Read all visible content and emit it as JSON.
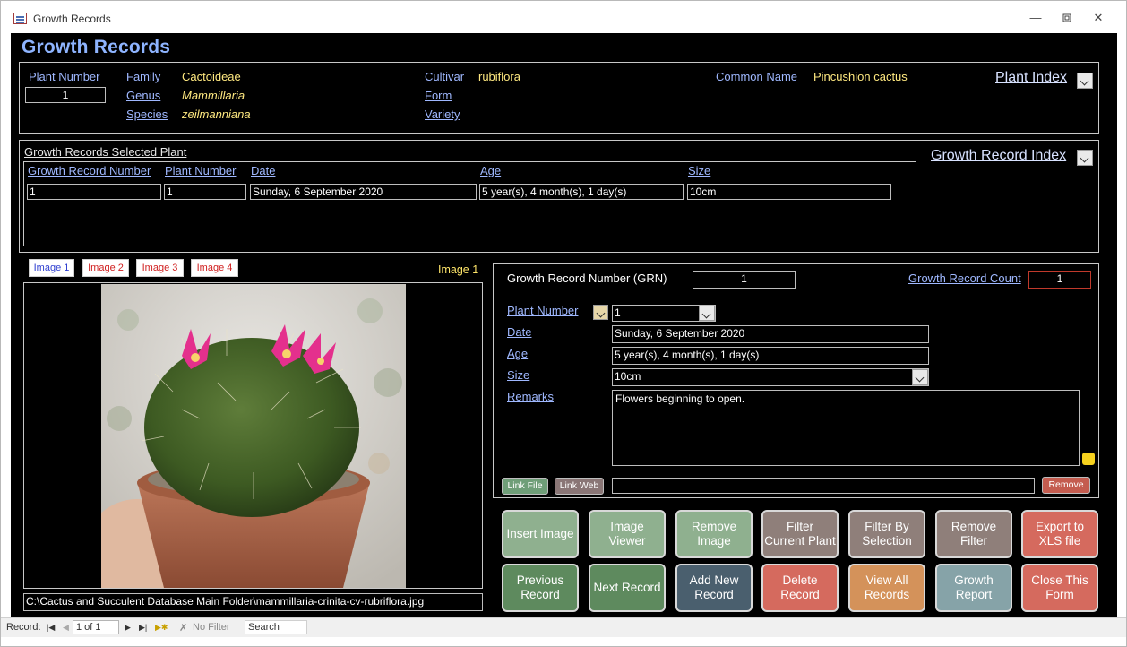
{
  "window": {
    "title": "Growth Records"
  },
  "form": {
    "title": "Growth Records"
  },
  "plant": {
    "plant_number_label": "Plant Number",
    "plant_number": "1",
    "family_label": "Family",
    "family": "Cactoideae",
    "genus_label": "Genus",
    "genus": "Mammillaria",
    "species_label": "Species",
    "species": "zeilmanniana",
    "cultivar_label": "Cultivar",
    "cultivar": "rubiflora",
    "form_label": "Form",
    "variety_label": "Variety",
    "common_name_label": "Common Name",
    "common_name": "Pincushion cactus",
    "plant_index_label": "Plant Index"
  },
  "selected": {
    "heading": "Growth Records Selected Plant",
    "growth_record_index_label": "Growth Record Index",
    "columns": [
      "Growth Record Number",
      "Plant Number",
      "Date",
      "Age",
      "Size"
    ],
    "row": [
      "1",
      "1",
      "Sunday, 6 September 2020",
      "5 year(s), 4 month(s), 1 day(s)",
      "10cm"
    ]
  },
  "images": {
    "tabs": [
      "Image 1",
      "Image 2",
      "Image 3",
      "Image 4"
    ],
    "current_label": "Image 1",
    "path": "C:\\Cactus and Succulent Database Main Folder\\mammillaria-crinita-cv-rubriflora.jpg"
  },
  "detail": {
    "grn_label": "Growth Record Number (GRN)",
    "grn": "1",
    "count_label": "Growth Record Count",
    "count": "1",
    "plant_number_label": "Plant Number",
    "plant_number": "1",
    "date_label": "Date",
    "date": "Sunday, 6 September 2020",
    "age_label": "Age",
    "age": "5 year(s), 4 month(s), 1 day(s)",
    "size_label": "Size",
    "size": "10cm",
    "remarks_label": "Remarks",
    "remarks": "Flowers beginning to open.",
    "link_file": "Link File",
    "link_web": "Link Web",
    "remove": "Remove"
  },
  "buttons": {
    "row1": [
      {
        "label": "Insert Image",
        "color": "#8fb08f"
      },
      {
        "label": "Image\nViewer",
        "color": "#8fb08f"
      },
      {
        "label": "Remove\nImage",
        "color": "#8fb08f"
      },
      {
        "label": "Filter\nCurrent Plant",
        "color": "#8f7f7a"
      },
      {
        "label": "Filter By\nSelection",
        "color": "#8f7f7a"
      },
      {
        "label": "Remove\nFilter",
        "color": "#8f7f7a"
      },
      {
        "label": "Export to\nXLS file",
        "color": "#d56a5e"
      }
    ],
    "row2": [
      {
        "label": "Previous\nRecord",
        "color": "#5e8a5e"
      },
      {
        "label": "Next Record",
        "color": "#5e8a5e"
      },
      {
        "label": "Add New\nRecord",
        "color": "#4a5f6e"
      },
      {
        "label": "Delete\nRecord",
        "color": "#d56a5e"
      },
      {
        "label": "View All\nRecords",
        "color": "#d4925a"
      },
      {
        "label": "Growth\nReport",
        "color": "#86a3a8"
      },
      {
        "label": "Close This\nForm",
        "color": "#d56a5e"
      }
    ]
  },
  "statusbar": {
    "record_label": "Record:",
    "position": "1 of 1",
    "no_filter": "No Filter",
    "search": "Search"
  }
}
